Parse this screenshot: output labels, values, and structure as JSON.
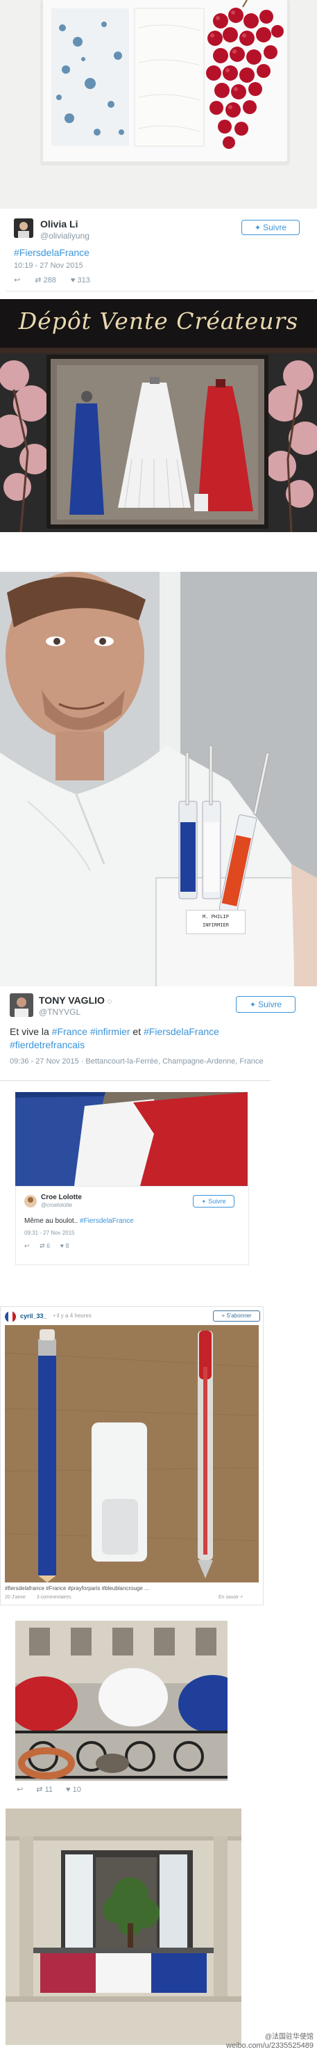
{
  "tweet1": {
    "name": "Olivia Li",
    "handle": "@olivialiyung",
    "follow": "Suivre",
    "hashtag": "#FiersdelaFrance",
    "timestamp": "10:19 - 27 Nov 2015",
    "retweets": "288",
    "likes": "313"
  },
  "shop": {
    "sign": "Dépôt Vente Créateurs"
  },
  "tweet2": {
    "name": "TONY VAGLIO",
    "handle": "@TNYVGL",
    "follow": "Suivre",
    "text_pre": "Et vive la ",
    "tag1": "#France",
    "tag2": "#infirmier",
    "text_mid": " et ",
    "tag3": "#FiersdelaFrance",
    "tag4": "#fierdetrefrancais",
    "meta": "09:36 - 27 Nov 2015 · Bettancourt-la-Ferrée, Champagne-Ardenne, France",
    "badge_line1": "M. PHILIP",
    "badge_line2": "INFIRMIER"
  },
  "tweet3": {
    "name": "Croe Lolotte",
    "handle": "@croelolotte",
    "follow": "Suivre",
    "text": "Même au boulot.. ",
    "tag": "#FiersdelaFrance",
    "timestamp": "09:31 - 27 Nov 2015",
    "retweets": "6",
    "likes": "8"
  },
  "post4": {
    "user": "cyril_33_",
    "time": "• il y a 4 heures",
    "follow": "+ S'abonner",
    "caption": "#fiersdelafrance #France #prayforparis #bleublancrouge ...",
    "likes": "20 J'aime",
    "comments": "3 commentaires",
    "more": "En savoir +"
  },
  "post5": {
    "retweets": "11",
    "likes": "10"
  },
  "watermark": {
    "line1": "@法国驻华使馆",
    "line2": "weibo.com/u/2335525489"
  },
  "colors": {
    "blue": "#1f3f9a",
    "white": "#f4f4f4",
    "red": "#c42128",
    "twitter_blue": "#3b94d9"
  }
}
